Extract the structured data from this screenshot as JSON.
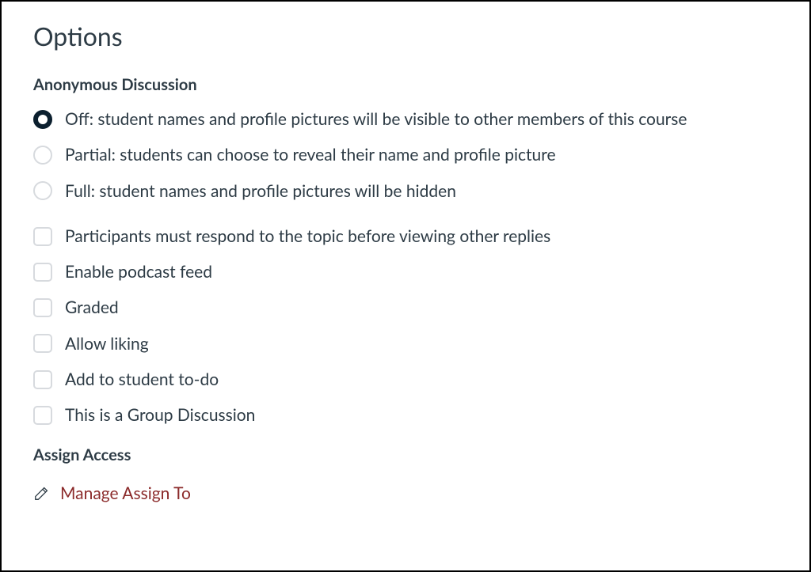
{
  "title": "Options",
  "anonymous_discussion": {
    "heading": "Anonymous Discussion",
    "selected": 0,
    "options": [
      "Off: student names and profile pictures will be visible to other members of this course",
      "Partial: students can choose to reveal their name and profile picture",
      "Full: student names and profile pictures will be hidden"
    ]
  },
  "checkboxes": [
    "Participants must respond to the topic before viewing other replies",
    "Enable podcast feed",
    "Graded",
    "Allow liking",
    "Add to student to-do",
    "This is a Group Discussion"
  ],
  "assign_access": {
    "heading": "Assign Access",
    "manage_label": "Manage Assign To"
  }
}
